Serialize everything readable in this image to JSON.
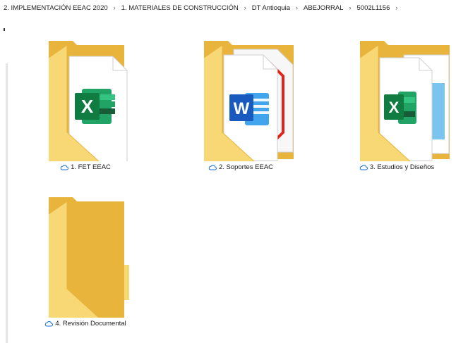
{
  "breadcrumb": {
    "items": [
      "2. IMPLEMENTACIÓN EEAC 2020",
      "1. MATERIALES DE CONSTRUCCIÓN",
      "DT Antioquia",
      "ABEJORRAL",
      "5002L1156"
    ],
    "separator": "›"
  },
  "folders": [
    {
      "name": "1. FET EEAC",
      "sync_status_icon": "cloud-icon",
      "preview": "excel-document"
    },
    {
      "name": "2. Soportes EEAC",
      "sync_status_icon": "cloud-icon",
      "preview": "word-and-pdf-documents"
    },
    {
      "name": "3. Estudios y Diseños",
      "sync_status_icon": "cloud-icon",
      "preview": "excel-and-image-documents"
    },
    {
      "name": "4. Revisión Documental",
      "sync_status_icon": "cloud-icon",
      "preview": "empty"
    }
  ],
  "colors": {
    "folder_back": "#E8B43C",
    "folder_front": "#F8D775",
    "excel_green": "#107C41",
    "word_blue": "#185ABD",
    "pdf_red": "#E1251B",
    "cloud_outline": "#1A73D9"
  }
}
